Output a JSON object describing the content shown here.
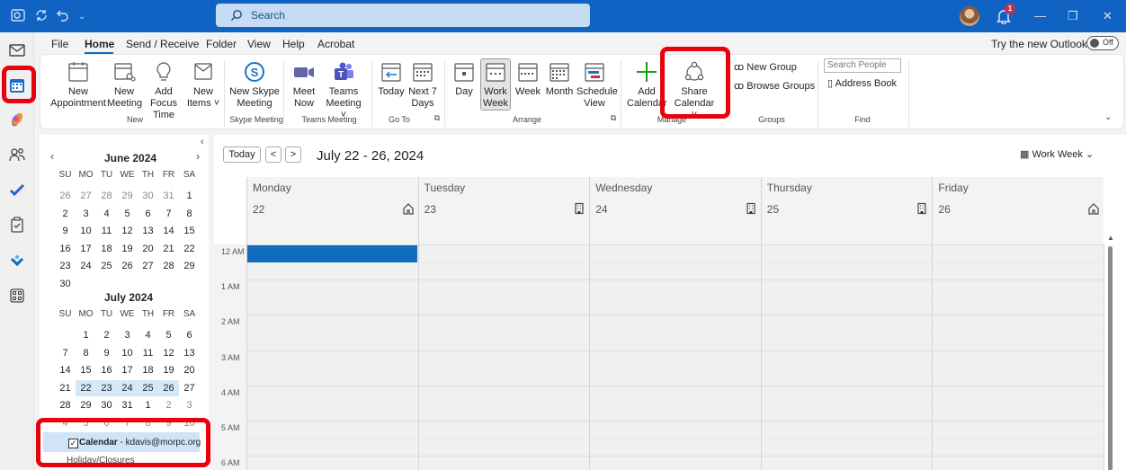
{
  "search": {
    "placeholder": "Search"
  },
  "notifications": {
    "count": "1"
  },
  "menu": {
    "items": [
      "File",
      "Home",
      "Send / Receive",
      "Folder",
      "View",
      "Help",
      "Acrobat"
    ],
    "active": "Home"
  },
  "try_new": {
    "label": "Try the new Outlook",
    "toggle": "Off"
  },
  "ribbon": {
    "new_appointment": [
      "New",
      "Appointment"
    ],
    "new_meeting": [
      "New",
      "Meeting"
    ],
    "add_focus_time": [
      "Add Focus",
      "Time"
    ],
    "new_items": [
      "New",
      "Items ˅"
    ],
    "group_new": "New",
    "new_skype": [
      "New Skype",
      "Meeting"
    ],
    "group_skype": "Skype Meeting",
    "meet_now": [
      "Meet",
      "Now"
    ],
    "teams_meeting": [
      "Teams",
      "Meeting ˅"
    ],
    "group_teams": "Teams Meeting",
    "today": "Today",
    "next7": [
      "Next 7",
      "Days"
    ],
    "group_goto": "Go To",
    "day": "Day",
    "work_week": [
      "Work",
      "Week"
    ],
    "week": "Week",
    "month": "Month",
    "schedule_view": [
      "Schedule",
      "View"
    ],
    "group_arrange": "Arrange",
    "add_calendar": [
      "Add",
      "Calendar"
    ],
    "group_manage": "Manage",
    "share_calendar": [
      "Share",
      "Calendar ˅"
    ],
    "new_group": "New Group",
    "browse_groups": "Browse Groups",
    "group_groups": "Groups",
    "search_people": "Search People",
    "address_book": "Address Book",
    "group_find": "Find"
  },
  "minical": {
    "dow": [
      "SU",
      "MO",
      "TU",
      "WE",
      "TH",
      "FR",
      "SA"
    ],
    "june": {
      "title": "June 2024",
      "weeks": [
        [
          "26",
          "27",
          "28",
          "29",
          "30",
          "31",
          "1"
        ],
        [
          "2",
          "3",
          "4",
          "5",
          "6",
          "7",
          "8"
        ],
        [
          "9",
          "10",
          "11",
          "12",
          "13",
          "14",
          "15"
        ],
        [
          "16",
          "17",
          "18",
          "19",
          "20",
          "21",
          "22"
        ],
        [
          "23",
          "24",
          "25",
          "26",
          "27",
          "28",
          "29"
        ],
        [
          "30",
          "",
          "",
          "",
          "",
          "",
          ""
        ]
      ]
    },
    "july": {
      "title": "July 2024",
      "weeks": [
        [
          "",
          "1",
          "2",
          "3",
          "4",
          "5",
          "6"
        ],
        [
          "7",
          "8",
          "9",
          "10",
          "11",
          "12",
          "13"
        ],
        [
          "14",
          "15",
          "16",
          "17",
          "18",
          "19",
          "20"
        ],
        [
          "21",
          "22",
          "23",
          "24",
          "25",
          "26",
          "27"
        ],
        [
          "28",
          "29",
          "30",
          "31",
          "1",
          "2",
          "3"
        ],
        [
          "4",
          "5",
          "6",
          "7",
          "8",
          "9",
          "10"
        ]
      ]
    }
  },
  "folders": {
    "calendar_name": "Calendar",
    "calendar_account": " - kdavis@morpc.org",
    "next": "Holiday/Closures"
  },
  "main": {
    "today_button": "Today",
    "range": "July 22 - 26, 2024",
    "view": "Work Week",
    "days": [
      {
        "name": "Monday",
        "num": "22",
        "icon": "home-icon"
      },
      {
        "name": "Tuesday",
        "num": "23",
        "icon": "building-icon"
      },
      {
        "name": "Wednesday",
        "num": "24",
        "icon": "building-icon"
      },
      {
        "name": "Thursday",
        "num": "25",
        "icon": "building-icon"
      },
      {
        "name": "Friday",
        "num": "26",
        "icon": "home-icon"
      }
    ],
    "times": [
      "12 AM",
      "1 AM",
      "2 AM",
      "3 AM",
      "4 AM",
      "5 AM",
      "6 AM"
    ]
  },
  "colors": {
    "titlebar": "#1063c2",
    "accent": "#0f6cbd",
    "highlight": "#e8000d"
  }
}
